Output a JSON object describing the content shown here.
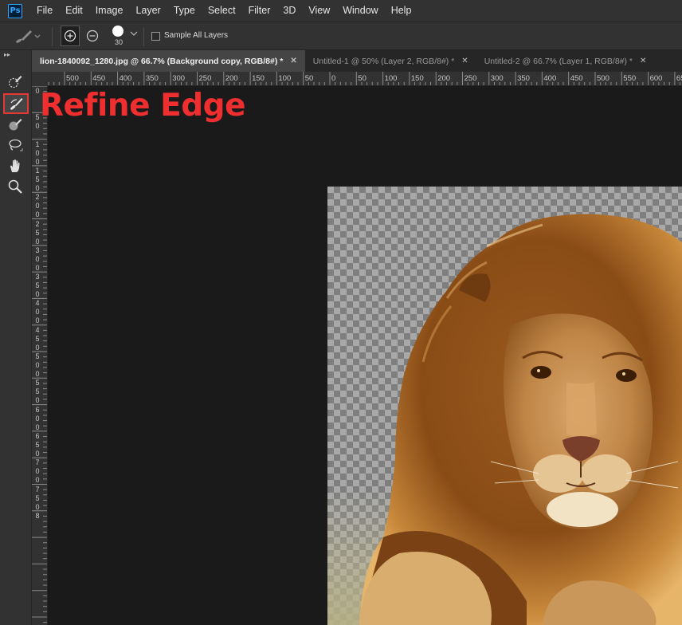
{
  "app": {
    "logo_text": "Ps"
  },
  "menu": [
    "File",
    "Edit",
    "Image",
    "Layer",
    "Type",
    "Select",
    "Filter",
    "3D",
    "View",
    "Window",
    "Help"
  ],
  "options": {
    "brush_size": "30",
    "sample_all_layers_label": "Sample All Layers",
    "sample_all_layers_checked": false
  },
  "tabs": [
    {
      "label": "lion-1840092_1280.jpg @ 66.7% (Background copy, RGB/8#) *",
      "active": true
    },
    {
      "label": "Untitled-1 @ 50% (Layer 2, RGB/8#) *",
      "active": false
    },
    {
      "label": "Untitled-2 @ 66.7% (Layer 1, RGB/8#) *",
      "active": false
    }
  ],
  "annotation": "Refine Edge",
  "tools": [
    "quick-selection",
    "refine-edge-brush",
    "brush",
    "lasso",
    "hand",
    "zoom"
  ],
  "ruler_top": [
    "500",
    "450",
    "400",
    "350",
    "300",
    "250",
    "200",
    "150",
    "100",
    "50",
    "0",
    "50",
    "100",
    "150",
    "200",
    "250",
    "300",
    "350",
    "400",
    "450",
    "500",
    "550",
    "600",
    "65"
  ],
  "ruler_left": [
    "0",
    "50",
    "100",
    "150",
    "200",
    "250",
    "300",
    "350",
    "400",
    "450",
    "500",
    "550",
    "600",
    "650",
    "700",
    "750",
    "8"
  ],
  "colors": {
    "accent_red": "#ef2f2f",
    "ps_blue": "#31a8ff",
    "ui_dark": "#323232",
    "canvas": "#1a1a1a"
  }
}
